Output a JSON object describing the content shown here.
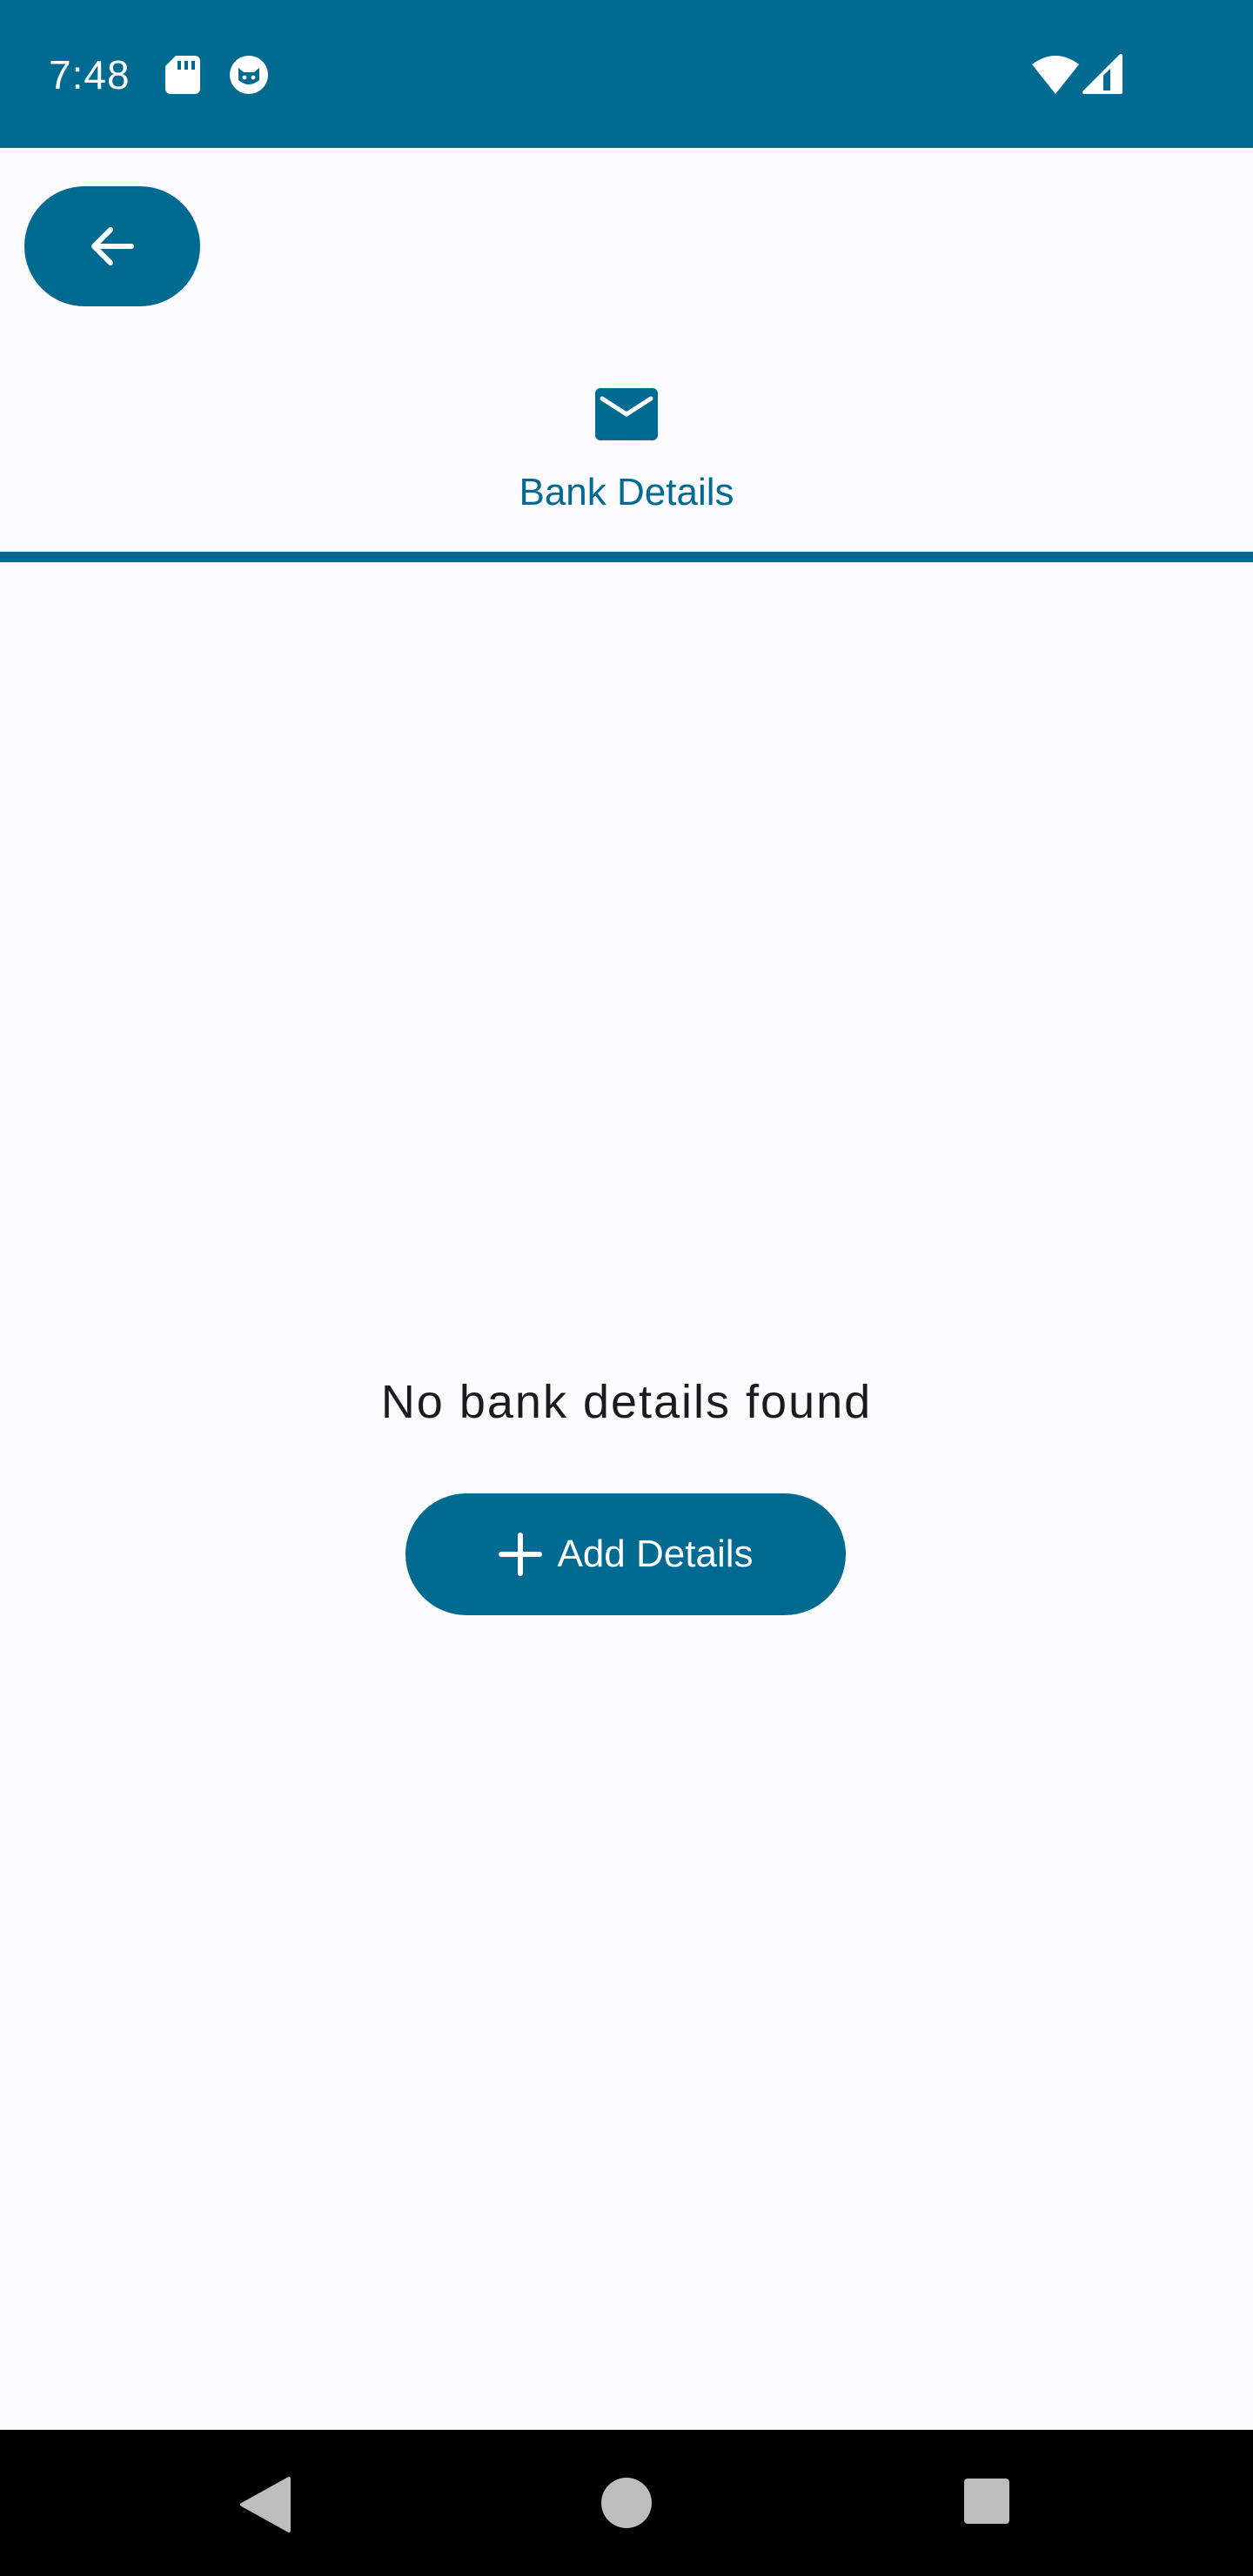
{
  "status_bar": {
    "time": "7:48",
    "background_color": "#006a91",
    "icons": [
      "sd-card-icon",
      "cat-icon",
      "wifi-icon",
      "signal-icon"
    ]
  },
  "header": {
    "back_button_icon": "arrow-back-icon"
  },
  "tabs": [
    {
      "label": "Bank Details",
      "icon": "envelope-icon",
      "selected": true
    }
  ],
  "empty_state": {
    "message": "No bank details found",
    "add_button_label": "Add Details",
    "add_button_icon": "plus-icon"
  },
  "nav_bar": {
    "icons": [
      "nav-back-icon",
      "nav-home-icon",
      "nav-recents-icon"
    ]
  },
  "colors": {
    "primary": "#006a91",
    "background": "#fbfbfe",
    "text": "#1b1b1f"
  }
}
